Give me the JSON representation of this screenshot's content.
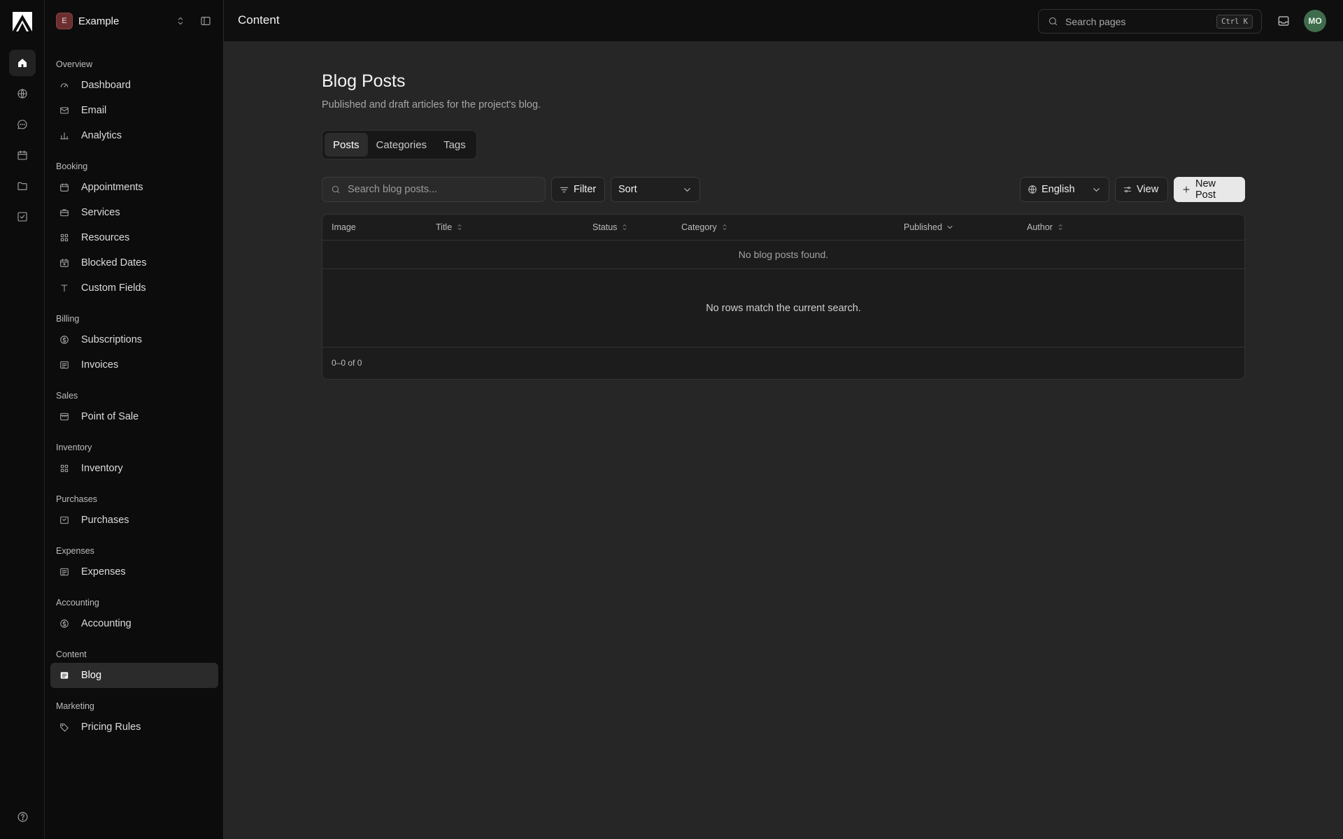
{
  "app": {
    "logo": "app-logo"
  },
  "rail": {
    "items": [
      {
        "icon": "home-icon"
      },
      {
        "icon": "globe-icon"
      },
      {
        "icon": "message-icon"
      },
      {
        "icon": "calendar-icon"
      },
      {
        "icon": "folder-icon"
      },
      {
        "icon": "checkbox-icon"
      }
    ],
    "help_icon": "help-icon"
  },
  "workspace": {
    "initial": "E",
    "name": "Example"
  },
  "sidebar": {
    "groups": [
      {
        "label": "Overview",
        "items": [
          {
            "label": "Dashboard",
            "icon": "gauge-icon"
          },
          {
            "label": "Email",
            "icon": "mail-icon"
          },
          {
            "label": "Analytics",
            "icon": "bar-chart-icon"
          }
        ]
      },
      {
        "label": "Booking",
        "items": [
          {
            "label": "Appointments",
            "icon": "calendar-icon"
          },
          {
            "label": "Services",
            "icon": "briefcase-icon"
          },
          {
            "label": "Resources",
            "icon": "grid-icon"
          },
          {
            "label": "Blocked Dates",
            "icon": "calendar-x-icon"
          },
          {
            "label": "Custom Fields",
            "icon": "text-icon"
          }
        ]
      },
      {
        "label": "Billing",
        "items": [
          {
            "label": "Subscriptions",
            "icon": "dollar-circle-icon"
          },
          {
            "label": "Invoices",
            "icon": "receipt-icon"
          }
        ]
      },
      {
        "label": "Sales",
        "items": [
          {
            "label": "Point of Sale",
            "icon": "store-icon"
          }
        ]
      },
      {
        "label": "Inventory",
        "items": [
          {
            "label": "Inventory",
            "icon": "grid-icon"
          }
        ]
      },
      {
        "label": "Purchases",
        "items": [
          {
            "label": "Purchases",
            "icon": "inbox-check-icon"
          }
        ]
      },
      {
        "label": "Expenses",
        "items": [
          {
            "label": "Expenses",
            "icon": "receipt-icon"
          }
        ]
      },
      {
        "label": "Accounting",
        "items": [
          {
            "label": "Accounting",
            "icon": "dollar-circle-icon"
          }
        ]
      },
      {
        "label": "Content",
        "items": [
          {
            "label": "Blog",
            "icon": "newspaper-icon",
            "active": true
          }
        ]
      },
      {
        "label": "Marketing",
        "items": [
          {
            "label": "Pricing Rules",
            "icon": "tag-icon"
          }
        ]
      }
    ]
  },
  "topbar": {
    "title": "Content",
    "search_placeholder": "Search pages",
    "shortcut": "Ctrl K",
    "avatar_initials": "MO"
  },
  "page": {
    "title": "Blog Posts",
    "subtitle": "Published and draft articles for the project's blog.",
    "tabs": [
      "Posts",
      "Categories",
      "Tags"
    ],
    "active_tab": "Posts"
  },
  "toolbar": {
    "search_placeholder": "Search blog posts...",
    "filter_label": "Filter",
    "sort_label": "Sort",
    "language_value": "English",
    "view_label": "View",
    "new_label": "New Post"
  },
  "table": {
    "columns": [
      "Image",
      "Title",
      "Status",
      "Category",
      "Published",
      "Author"
    ],
    "empty_row": "No blog posts found.",
    "empty_message": "No rows match the current search.",
    "pagination": "0–0 of 0"
  }
}
